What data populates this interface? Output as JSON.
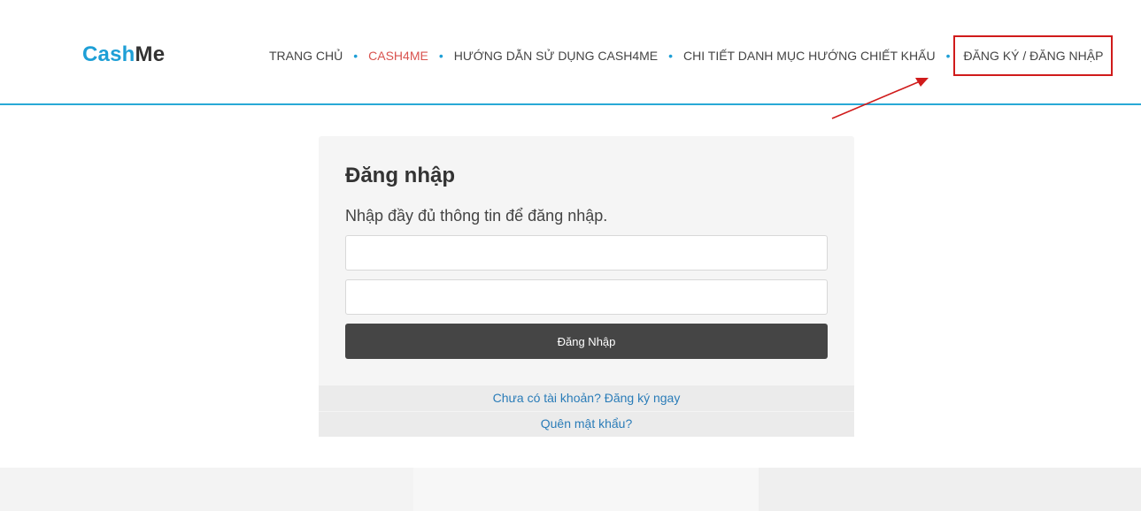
{
  "brand": {
    "part1": "Cash",
    "part2": "Me"
  },
  "nav": {
    "items": [
      {
        "label": "TRANG CHỦ"
      },
      {
        "label": "CASH4ME"
      },
      {
        "label": "HƯỚNG DẪN SỬ DỤNG CASH4ME"
      },
      {
        "label": "CHI TIẾT DANH MỤC HƯỚNG CHIẾT KHẤU"
      },
      {
        "label": "ĐĂNG KÝ / ĐĂNG NHẬP"
      }
    ],
    "separator": "•"
  },
  "login": {
    "title": "Đăng nhập",
    "subtitle": "Nhập đầy đủ thông tin để đăng nhập.",
    "username_value": "",
    "password_value": "",
    "button_label": "Đăng Nhập",
    "register_link": "Chưa có tài khoản? Đăng ký ngay",
    "forgot_link": "Quên mật khẩu?"
  },
  "colors": {
    "brand_blue": "#1e9fd6",
    "active_nav": "#d9534f",
    "annotation_red": "#d01b1b",
    "button_dark": "#454545",
    "link_blue": "#2a7cb8"
  }
}
